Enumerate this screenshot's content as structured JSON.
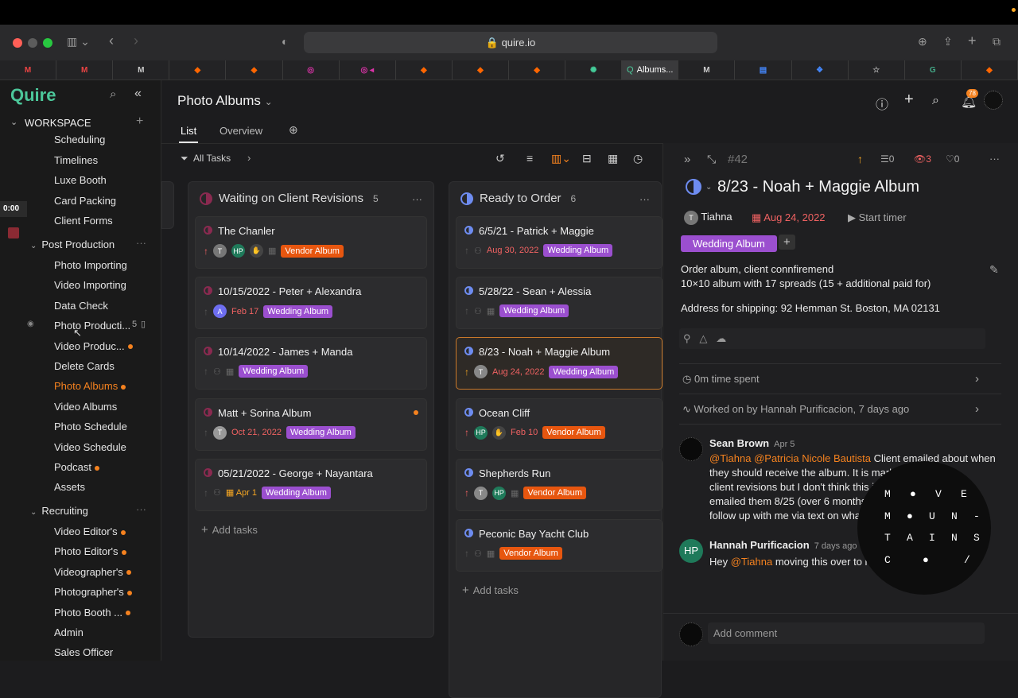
{
  "browser": {
    "url": "quire.io",
    "active_tab": "Albums..."
  },
  "sidebar": {
    "logo": "Quire",
    "workspace": "WORKSPACE",
    "timer": "0:00",
    "top_items": [
      "Scheduling",
      "Timelines",
      "Luxe Booth",
      "Card Packing",
      "Client Forms"
    ],
    "group_post": "Post Production",
    "post_items": [
      {
        "l": "Photo Importing",
        "d": false
      },
      {
        "l": "Video Importing",
        "d": false
      },
      {
        "l": "Data Check",
        "d": false
      },
      {
        "l": "Photo Producti...",
        "d": false
      },
      {
        "l": "Video Produc...",
        "d": true
      },
      {
        "l": "Delete Cards",
        "d": false
      },
      {
        "l": "Photo Albums",
        "d": true
      },
      {
        "l": "Video Albums",
        "d": false
      },
      {
        "l": "Photo Schedule",
        "d": false
      },
      {
        "l": "Video Schedule",
        "d": false
      },
      {
        "l": "Podcast",
        "d": true
      },
      {
        "l": "Assets",
        "d": false
      }
    ],
    "photo_prod_count": "5",
    "group_recruit": "Recruiting",
    "recruit_items": [
      {
        "l": "Video Editor's",
        "d": true
      },
      {
        "l": "Photo Editor's",
        "d": true
      },
      {
        "l": "Videographer's",
        "d": true
      },
      {
        "l": "Photographer's",
        "d": true
      },
      {
        "l": "Photo Booth ...",
        "d": true
      },
      {
        "l": "Admin",
        "d": false
      },
      {
        "l": "Sales Officer",
        "d": false
      }
    ]
  },
  "main": {
    "title": "Photo Albums",
    "tab_list": "List",
    "tab_overview": "Overview",
    "filter": "All Tasks"
  },
  "columns": [
    {
      "title": "Waiting on Client Revisions",
      "count": "5",
      "cards": [
        {
          "t": "The Chanler",
          "date": "",
          "tag": "Vendor Album",
          "tagtype": "ven"
        },
        {
          "t": "10/15/2022 - Peter + Alexandra",
          "date": "Feb 17",
          "tag": "Wedding Album",
          "tagtype": "wed"
        },
        {
          "t": "10/14/2022 - James + Manda",
          "date": "",
          "tag": "Wedding Album",
          "tagtype": "wed"
        },
        {
          "t": "Matt + Sorina Album",
          "date": "Oct 21, 2022",
          "tag": "Wedding Album",
          "tagtype": "wed"
        },
        {
          "t": "05/21/2022 - George + Nayantara",
          "date": "Apr 1",
          "tag": "Wedding Album",
          "tagtype": "wed"
        }
      ],
      "add": "Add tasks"
    },
    {
      "title": "Ready to Order",
      "count": "6",
      "cards": [
        {
          "t": "6/5/21 - Patrick + Maggie",
          "date": "Aug 30, 2022",
          "tag": "Wedding Album",
          "tagtype": "wed"
        },
        {
          "t": "5/28/22 - Sean + Alessia",
          "date": "",
          "tag": "Wedding Album",
          "tagtype": "wed"
        },
        {
          "t": "8/23 - Noah + Maggie Album",
          "date": "Aug 24, 2022",
          "tag": "Wedding Album",
          "tagtype": "wed"
        },
        {
          "t": "Ocean Cliff",
          "date": "Feb 10",
          "tag": "Vendor Album",
          "tagtype": "ven"
        },
        {
          "t": "Shepherds Run",
          "date": "",
          "tag": "Vendor Album",
          "tagtype": "ven"
        },
        {
          "t": "Peconic Bay Yacht Club",
          "date": "",
          "tag": "Vendor Album",
          "tagtype": "ven"
        }
      ],
      "add": "Add tasks"
    }
  ],
  "detail": {
    "id": "#42",
    "subtasks": "0",
    "watchers": "3",
    "likes": "0",
    "title": "8/23 - Noah + Maggie Album",
    "assignee": "Tiahna",
    "due": "Aug 24, 2022",
    "timer": "Start timer",
    "tag": "Wedding Album",
    "desc1": "Order album, client connfiremend",
    "desc2": "10×10 album with 17 spreads (15 + additional paid for)",
    "desc3": "Address for shipping: 92 Hemman St. Boston, MA 02131",
    "time_spent": "0m time spent",
    "worked_on": "Worked on by Hannah Purificacion, 7 days ago",
    "c1_name": "Sean Brown",
    "c1_time": "Apr 5",
    "c1_mention": "@Tiahna @Patricia Nicole Bautista",
    "c1_l1": " Client emailed about when",
    "c1_l2": "they should receive the album. It is mark",
    "c1_l3": "client revisions but I don't think this i",
    "c1_l4": "emailed them 8/25 (over 6 months",
    "c1_l5": "follow up with me via text on what",
    "c2_name": "Hannah Purificacion",
    "c2_time": "7 days ago",
    "c2_mention": "@Tiahna",
    "c2_text": " moving this over to re",
    "add_comment": "Add comment"
  },
  "overlay": {
    "row1": [
      "M",
      "●",
      "V",
      "E"
    ],
    "row2": [
      "M",
      "●",
      "U",
      "N",
      "-"
    ],
    "row3": [
      "T",
      "A",
      "I",
      "N",
      "S"
    ],
    "row4": [
      "C",
      "●",
      "/"
    ]
  },
  "notif_count": "78"
}
